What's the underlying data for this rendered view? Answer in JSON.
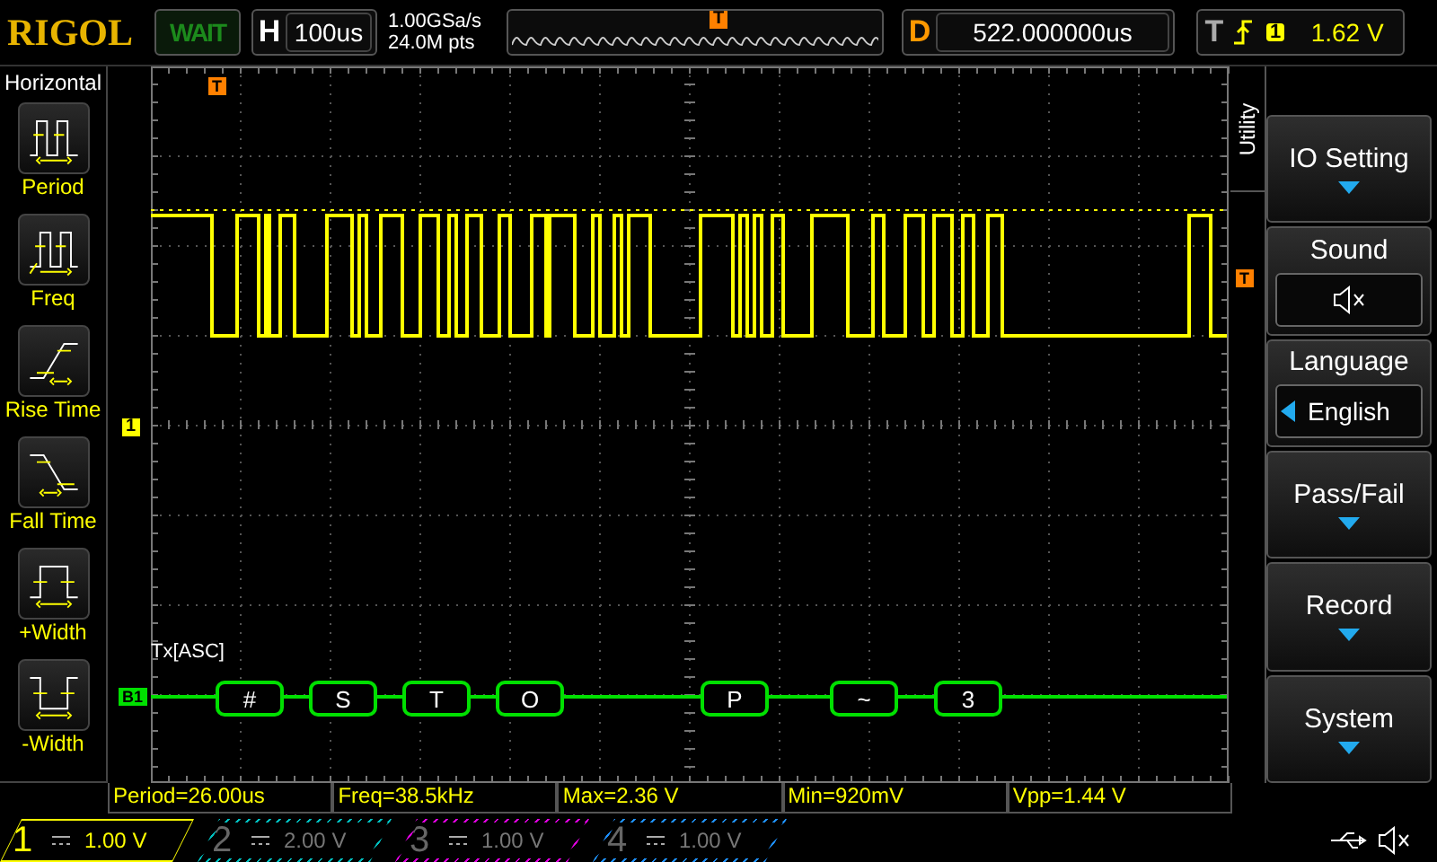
{
  "top_bar": {
    "logo": "RIGOL",
    "run_status": "WAIT",
    "horizontal": {
      "label": "H",
      "value": "100us"
    },
    "sample_rate": "1.00GSa/s",
    "memory_depth": "24.0M pts",
    "trigger_mark": "T",
    "delay": {
      "label": "D",
      "value": "522.000000us"
    },
    "trigger": {
      "label": "T",
      "source": "1",
      "level": "1.62 V"
    }
  },
  "left_menu": {
    "title": "Horizontal",
    "items": [
      {
        "kind": "period",
        "label": "Period"
      },
      {
        "kind": "freq",
        "label": "Freq"
      },
      {
        "kind": "rise",
        "label": "Rise Time"
      },
      {
        "kind": "fall",
        "label": "Fall Time"
      },
      {
        "kind": "pwidth",
        "label": "+Width"
      },
      {
        "kind": "nwidth",
        "label": "-Width"
      }
    ]
  },
  "plot": {
    "trigger_position": "T",
    "channel_marker": "1",
    "trigger_level_marker": "T",
    "bus_marker": "B1",
    "bus_label": "Tx[ASC]",
    "packets": [
      "#",
      "S",
      "T",
      "O",
      "P",
      "~",
      "3"
    ]
  },
  "right_menu": {
    "tab": "Utility",
    "items": [
      {
        "kind": "submenu",
        "label": "IO Setting"
      },
      {
        "kind": "icon",
        "label": "Sound"
      },
      {
        "kind": "value",
        "label": "Language",
        "value": "English"
      },
      {
        "kind": "submenu",
        "label": "Pass/Fail"
      },
      {
        "kind": "submenu",
        "label": "Record"
      },
      {
        "kind": "submenu",
        "label": "System"
      }
    ]
  },
  "measurements": [
    "Period=26.00us",
    "Freq=38.5kHz",
    "Max=2.36 V",
    "Min=920mV",
    "Vpp=1.44 V"
  ],
  "channels": [
    {
      "number": "1",
      "scale": "1.00 V",
      "color": "#ffff00",
      "selected": true
    },
    {
      "number": "2",
      "scale": "2.00 V",
      "color": "#00c0c0",
      "selected": false
    },
    {
      "number": "3",
      "scale": "1.00 V",
      "color": "#e000e0",
      "selected": false
    },
    {
      "number": "4",
      "scale": "1.00 V",
      "color": "#1e90ff",
      "selected": false
    }
  ]
}
